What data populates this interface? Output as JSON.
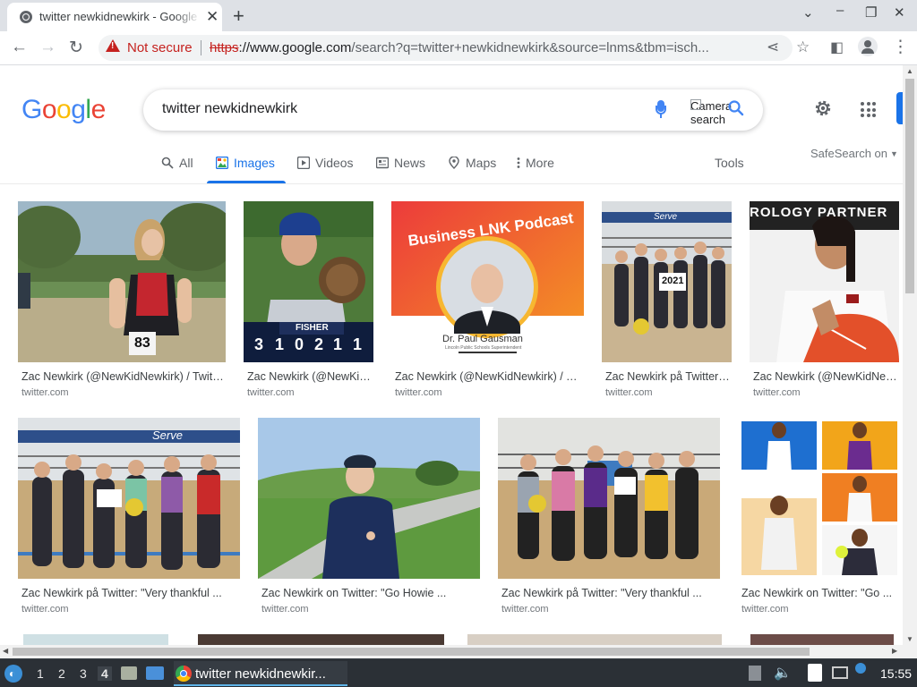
{
  "browser": {
    "tab_title": "twitter newkidnewkirk - Google Search",
    "tab_close": "✕",
    "new_tab": "+",
    "url_security": "Not secure",
    "url_scheme": "https",
    "url_host_prefix": "://www.google.com",
    "url_rest": "/search?q=twitter+newkidnewkirk&source=lnms&tbm=isch..."
  },
  "google": {
    "logo_letters": [
      "G",
      "o",
      "o",
      "g",
      "l",
      "e"
    ],
    "query": "twitter newkidnewkirk",
    "camera_alt": "Camera search"
  },
  "tabs": [
    {
      "label": "All",
      "icon": "search-icon"
    },
    {
      "label": "Images",
      "icon": "image-icon",
      "active": true
    },
    {
      "label": "Videos",
      "icon": "play-icon"
    },
    {
      "label": "News",
      "icon": "news-icon"
    },
    {
      "label": "Maps",
      "icon": "map-pin-icon"
    },
    {
      "label": "More",
      "icon": "more-vertical-icon"
    }
  ],
  "tools_label": "Tools",
  "safesearch_label": "SafeSearch on",
  "results": [
    {
      "caption": "Zac Newkirk (@NewKidNewkirk) / Twitter",
      "source": "twitter.com",
      "thumb": "girl-runner",
      "bib": "83"
    },
    {
      "caption": "Zac Newkirk (@NewKidNewkirk) / Twitter",
      "source": "twitter.com",
      "thumb": "baseball",
      "scoreboard": "FISHER",
      "digits": [
        "3",
        "1",
        "0",
        "2",
        "1",
        "1"
      ]
    },
    {
      "caption": "Zac Newkirk (@NewKidNewkirk) / Twitter",
      "source": "twitter.com",
      "thumb": "podcast",
      "podcast_title": "Business LNK Podcast",
      "podcast_name": "Dr. Paul Gausman",
      "podcast_sub": "Lincoln Public Schools Superintendent"
    },
    {
      "caption": "Zac Newkirk på Twitter: \"Very thankful ...",
      "source": "twitter.com",
      "thumb": "volleyball-team",
      "sign": "2021"
    },
    {
      "caption": "Zac Newkirk (@NewKidNewkirk) / Twitter",
      "source": "twitter.com",
      "thumb": "signing",
      "banner": "ROLOGY PARTNER"
    },
    {
      "caption": "Zac Newkirk på Twitter: \"Very thankful ...",
      "source": "twitter.com",
      "thumb": "volleyball-group",
      "banner": "Serve"
    },
    {
      "caption": "Zac Newkirk on Twitter: \"Go Howie ...",
      "source": "twitter.com",
      "thumb": "golfer"
    },
    {
      "caption": "Zac Newkirk på Twitter: \"Very thankful ...",
      "source": "twitter.com",
      "thumb": "volleyball-group2"
    },
    {
      "caption": "Zac Newkirk on Twitter: \"Go ...",
      "source": "twitter.com",
      "thumb": "collage"
    }
  ],
  "taskbar": {
    "workspaces": [
      "1",
      "2",
      "3",
      "4"
    ],
    "active_workspace": "4",
    "app_label": "twitter newkidnewkir...",
    "clock": "15:55"
  }
}
